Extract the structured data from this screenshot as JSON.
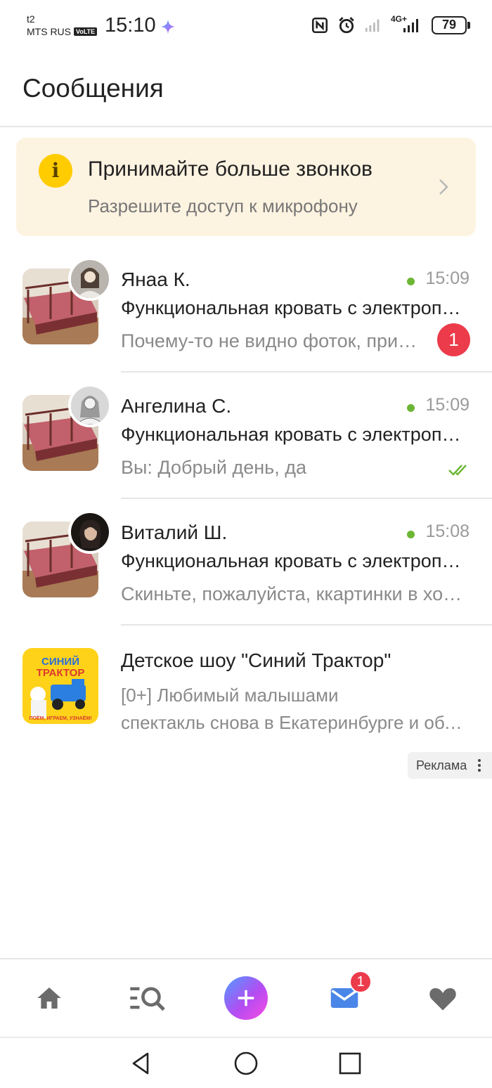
{
  "status_bar": {
    "carrier_top": "t2",
    "carrier_bottom": "MTS RUS",
    "volte": "VoLTE",
    "time": "15:10",
    "network": "4G+",
    "battery": "79"
  },
  "header": {
    "title": "Сообщения"
  },
  "banner": {
    "title": "Принимайте больше звонков",
    "subtitle": "Разрешите доступ к микрофону",
    "icon": "info-icon"
  },
  "chats": [
    {
      "name": "Янаа К.",
      "time": "15:09",
      "online": true,
      "subject": "Функциональная кровать с электроприводом",
      "preview": "Почему-то не видно фоток, пришлите ещё раз",
      "unread": "1"
    },
    {
      "name": "Ангелина С.",
      "time": "15:09",
      "online": true,
      "subject": "Функциональная кровать с электроприводом",
      "preview": "Вы: Добрый день, да",
      "read": true
    },
    {
      "name": "Виталий Ш.",
      "time": "15:08",
      "online": true,
      "subject": "Функциональная кровать с электроприводом",
      "preview": "Скиньте, пожалуйста, ккартинки в хорошем качестве"
    }
  ],
  "ad": {
    "title": "Детское шоу \"Синий Трактор\"",
    "line1": "[0+] Любимый малышами",
    "line2": "спектакль снова в Екатеринбурге и области",
    "thumb_lines": [
      "СИНИЙ",
      "ТРАКТОР",
      "ПОЁМ, ИГРАЕМ, УЗНАЁМ!"
    ],
    "label": "Реклама"
  },
  "bottom_nav": {
    "items": [
      "home-icon",
      "search-icon",
      "add-icon",
      "messages-icon",
      "favorites-icon"
    ],
    "messages_badge": "1"
  },
  "colors": {
    "accent_red": "#ec3b4b",
    "online_green": "#6bb634",
    "banner_bg": "#fdf3e1",
    "info_yellow": "#ffcc00"
  }
}
